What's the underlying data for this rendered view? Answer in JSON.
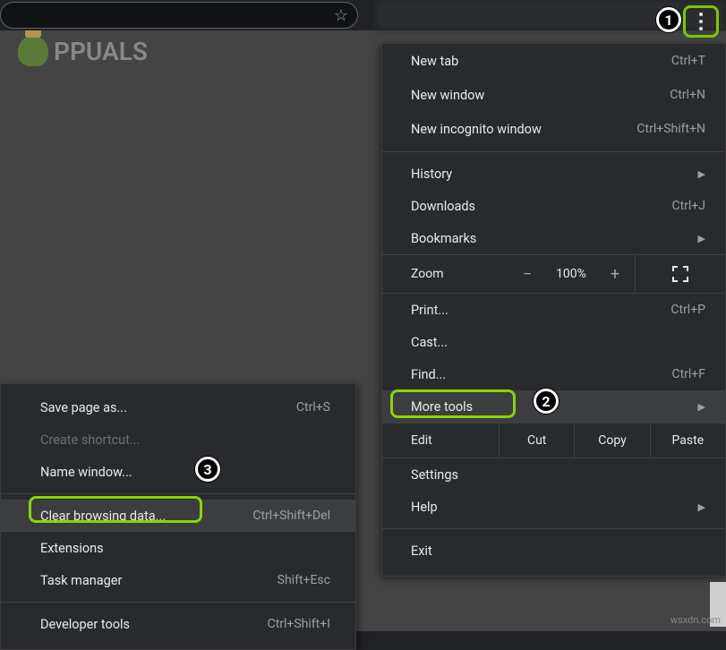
{
  "logo_text": "PPUALS",
  "main_menu": {
    "new_tab": {
      "label": "New tab",
      "shortcut": "Ctrl+T"
    },
    "new_window": {
      "label": "New window",
      "shortcut": "Ctrl+N"
    },
    "new_incognito": {
      "label": "New incognito window",
      "shortcut": "Ctrl+Shift+N"
    },
    "history": {
      "label": "History"
    },
    "downloads": {
      "label": "Downloads",
      "shortcut": "Ctrl+J"
    },
    "bookmarks": {
      "label": "Bookmarks"
    },
    "zoom": {
      "label": "Zoom",
      "minus": "−",
      "pct": "100%",
      "plus": "+"
    },
    "print": {
      "label": "Print...",
      "shortcut": "Ctrl+P"
    },
    "cast": {
      "label": "Cast..."
    },
    "find": {
      "label": "Find...",
      "shortcut": "Ctrl+F"
    },
    "more_tools": {
      "label": "More tools"
    },
    "edit": {
      "label": "Edit",
      "cut": "Cut",
      "copy": "Copy",
      "paste": "Paste"
    },
    "settings": {
      "label": "Settings"
    },
    "help": {
      "label": "Help"
    },
    "exit": {
      "label": "Exit"
    }
  },
  "sub_menu": {
    "save_page": {
      "label": "Save page as...",
      "shortcut": "Ctrl+S"
    },
    "create_shortcut": {
      "label": "Create shortcut..."
    },
    "name_window": {
      "label": "Name window..."
    },
    "clear_browsing_data": {
      "label": "Clear browsing data...",
      "shortcut": "Ctrl+Shift+Del"
    },
    "extensions": {
      "label": "Extensions"
    },
    "task_manager": {
      "label": "Task manager",
      "shortcut": "Shift+Esc"
    },
    "developer_tools": {
      "label": "Developer tools",
      "shortcut": "Ctrl+Shift+I"
    }
  },
  "badges": {
    "b1": "1",
    "b2": "2",
    "b3": "3"
  },
  "watermark": "wsxdn.com"
}
